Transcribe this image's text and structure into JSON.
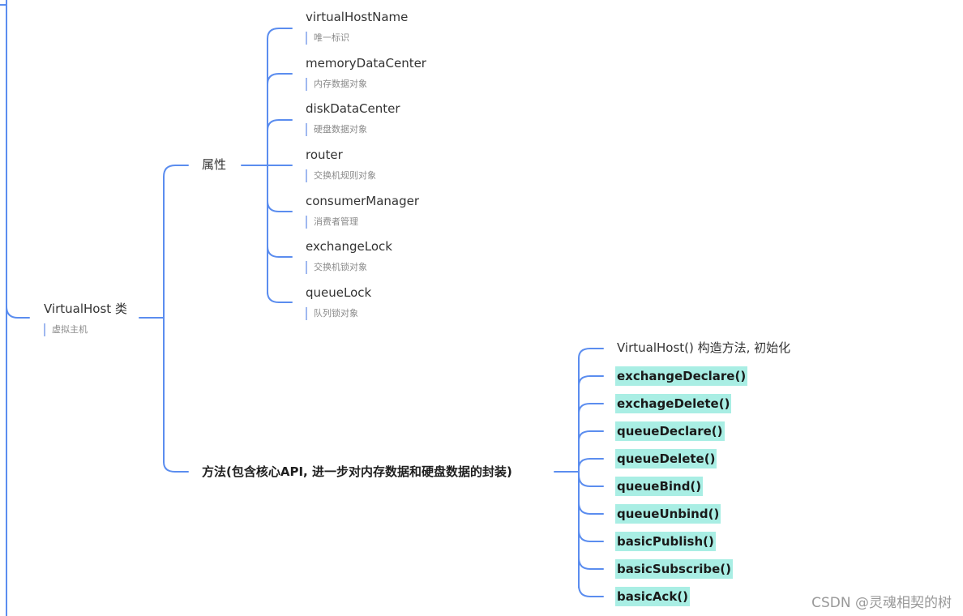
{
  "root": {
    "label": "VirtualHost 类",
    "note": "虚拟主机"
  },
  "attributes": {
    "label": "属性",
    "items": [
      {
        "name": "virtualHostName",
        "note": "唯一标识"
      },
      {
        "name": "memoryDataCenter",
        "note": "内存数据对象"
      },
      {
        "name": "diskDataCenter",
        "note": "硬盘数据对象"
      },
      {
        "name": "router",
        "note": "交换机规则对象"
      },
      {
        "name": "consumerManager",
        "note": "消费者管理"
      },
      {
        "name": "exchangeLock",
        "note": "交换机锁对象"
      },
      {
        "name": "queueLock",
        "note": "队列锁对象"
      }
    ]
  },
  "methods": {
    "label": "方法(包含核心API, 进一步对内存数据和硬盘数据的封装)",
    "constructor": "VirtualHost()   构造方法, 初始化",
    "items": [
      "exchangeDeclare()",
      "exchageDelete()",
      "queueDeclare()",
      "queueDelete()",
      "queueBind()",
      "queueUnbind()",
      "basicPublish()",
      "basicSubscribe()",
      "basicAck()"
    ],
    "highlight_color": "#a9eee4"
  },
  "link_color": "#5b8def",
  "watermark": "CSDN @灵魂相契的树"
}
